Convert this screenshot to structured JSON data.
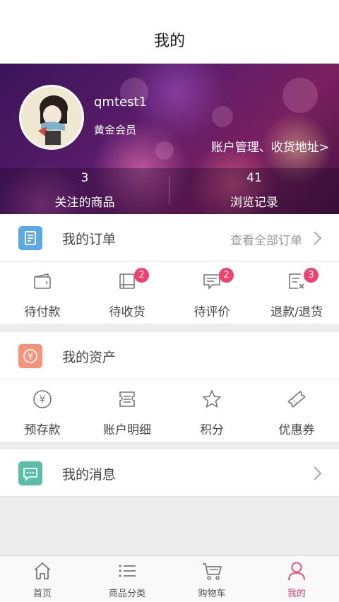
{
  "header": {
    "title": "我的"
  },
  "profile": {
    "username": "qmtest1",
    "member_level": "黄金会员",
    "account_link": "账户管理、收货地址>",
    "stats": [
      {
        "count": "3",
        "label": "关注的商品"
      },
      {
        "count": "41",
        "label": "浏览记录"
      }
    ]
  },
  "orders": {
    "title": "我的订单",
    "more": "查看全部订单",
    "icon": "order-list-icon",
    "icon_color": "#5aa9e6",
    "items": [
      {
        "label": "待付款",
        "icon": "wallet-icon",
        "badge": ""
      },
      {
        "label": "待收货",
        "icon": "book-box-icon",
        "badge": "2"
      },
      {
        "label": "待评价",
        "icon": "comment-icon",
        "badge": "2"
      },
      {
        "label": "退款/退货",
        "icon": "refund-icon",
        "badge": "3"
      }
    ]
  },
  "assets": {
    "title": "我的资产",
    "icon": "yen-icon",
    "icon_color": "#f7937a",
    "items": [
      {
        "label": "预存款",
        "icon": "yen-circle-icon"
      },
      {
        "label": "账户明细",
        "icon": "ticket-list-icon"
      },
      {
        "label": "积分",
        "icon": "star-icon"
      },
      {
        "label": "优惠券",
        "icon": "coupon-icon"
      }
    ]
  },
  "messages": {
    "title": "我的消息",
    "icon": "chat-bubble-icon",
    "icon_color": "#5bbfa8"
  },
  "tabbar": {
    "tabs": [
      {
        "label": "首页",
        "icon": "home-icon",
        "active": false
      },
      {
        "label": "商品分类",
        "icon": "list-icon",
        "active": false
      },
      {
        "label": "购物车",
        "icon": "cart-icon",
        "active": false
      },
      {
        "label": "我的",
        "icon": "person-icon",
        "active": true
      }
    ],
    "active_color": "#f0416f"
  }
}
